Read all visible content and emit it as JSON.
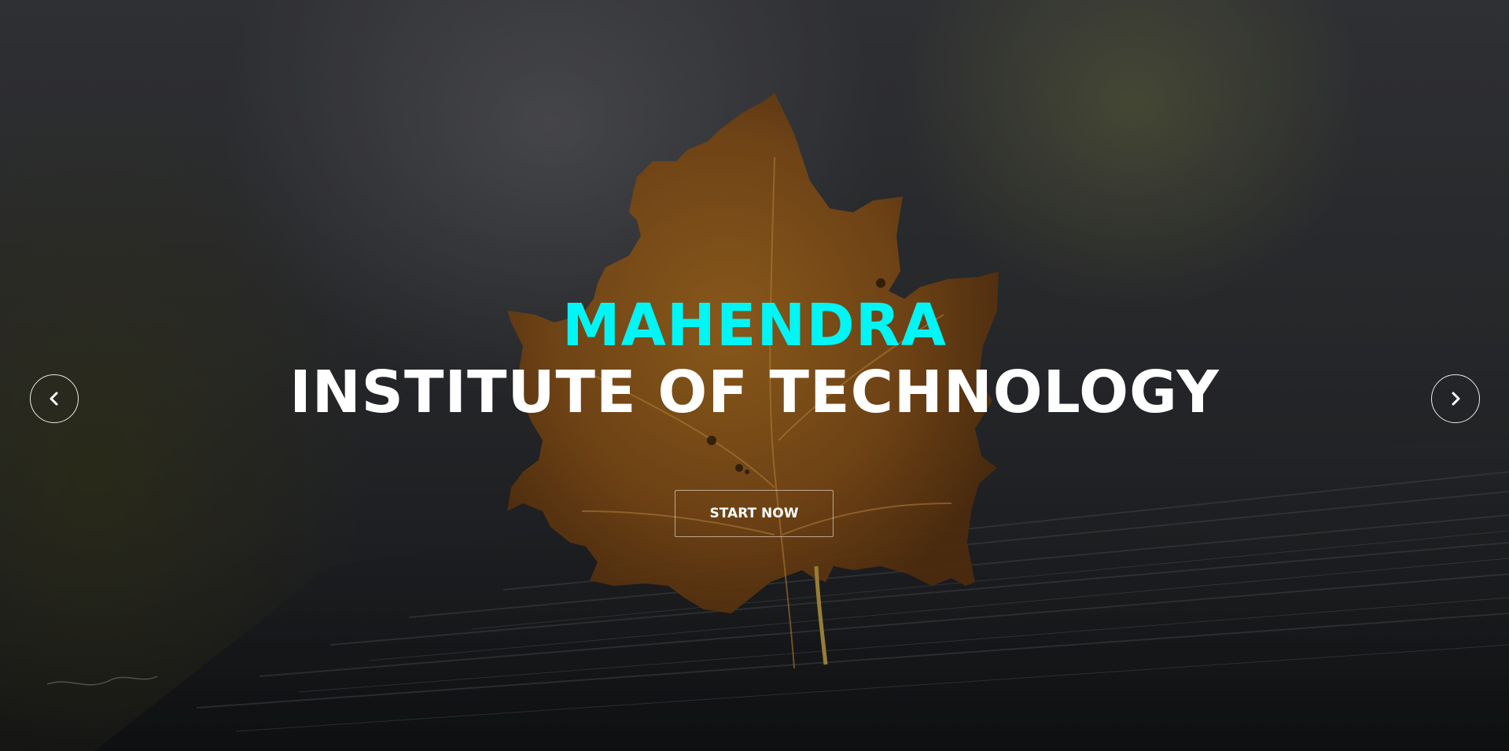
{
  "hero": {
    "title_line1": "MAHENDRA",
    "title_line2": "INSTITUTE OF TECHNOLOGY",
    "cta_label": "START NOW",
    "title_line1_color": "#00f5f5",
    "title_line2_color": "#ffffff",
    "background_image": "autumn maple leaf on dark wooden surface"
  },
  "carousel": {
    "prev_icon": "chevron-left-icon",
    "next_icon": "chevron-right-icon"
  }
}
